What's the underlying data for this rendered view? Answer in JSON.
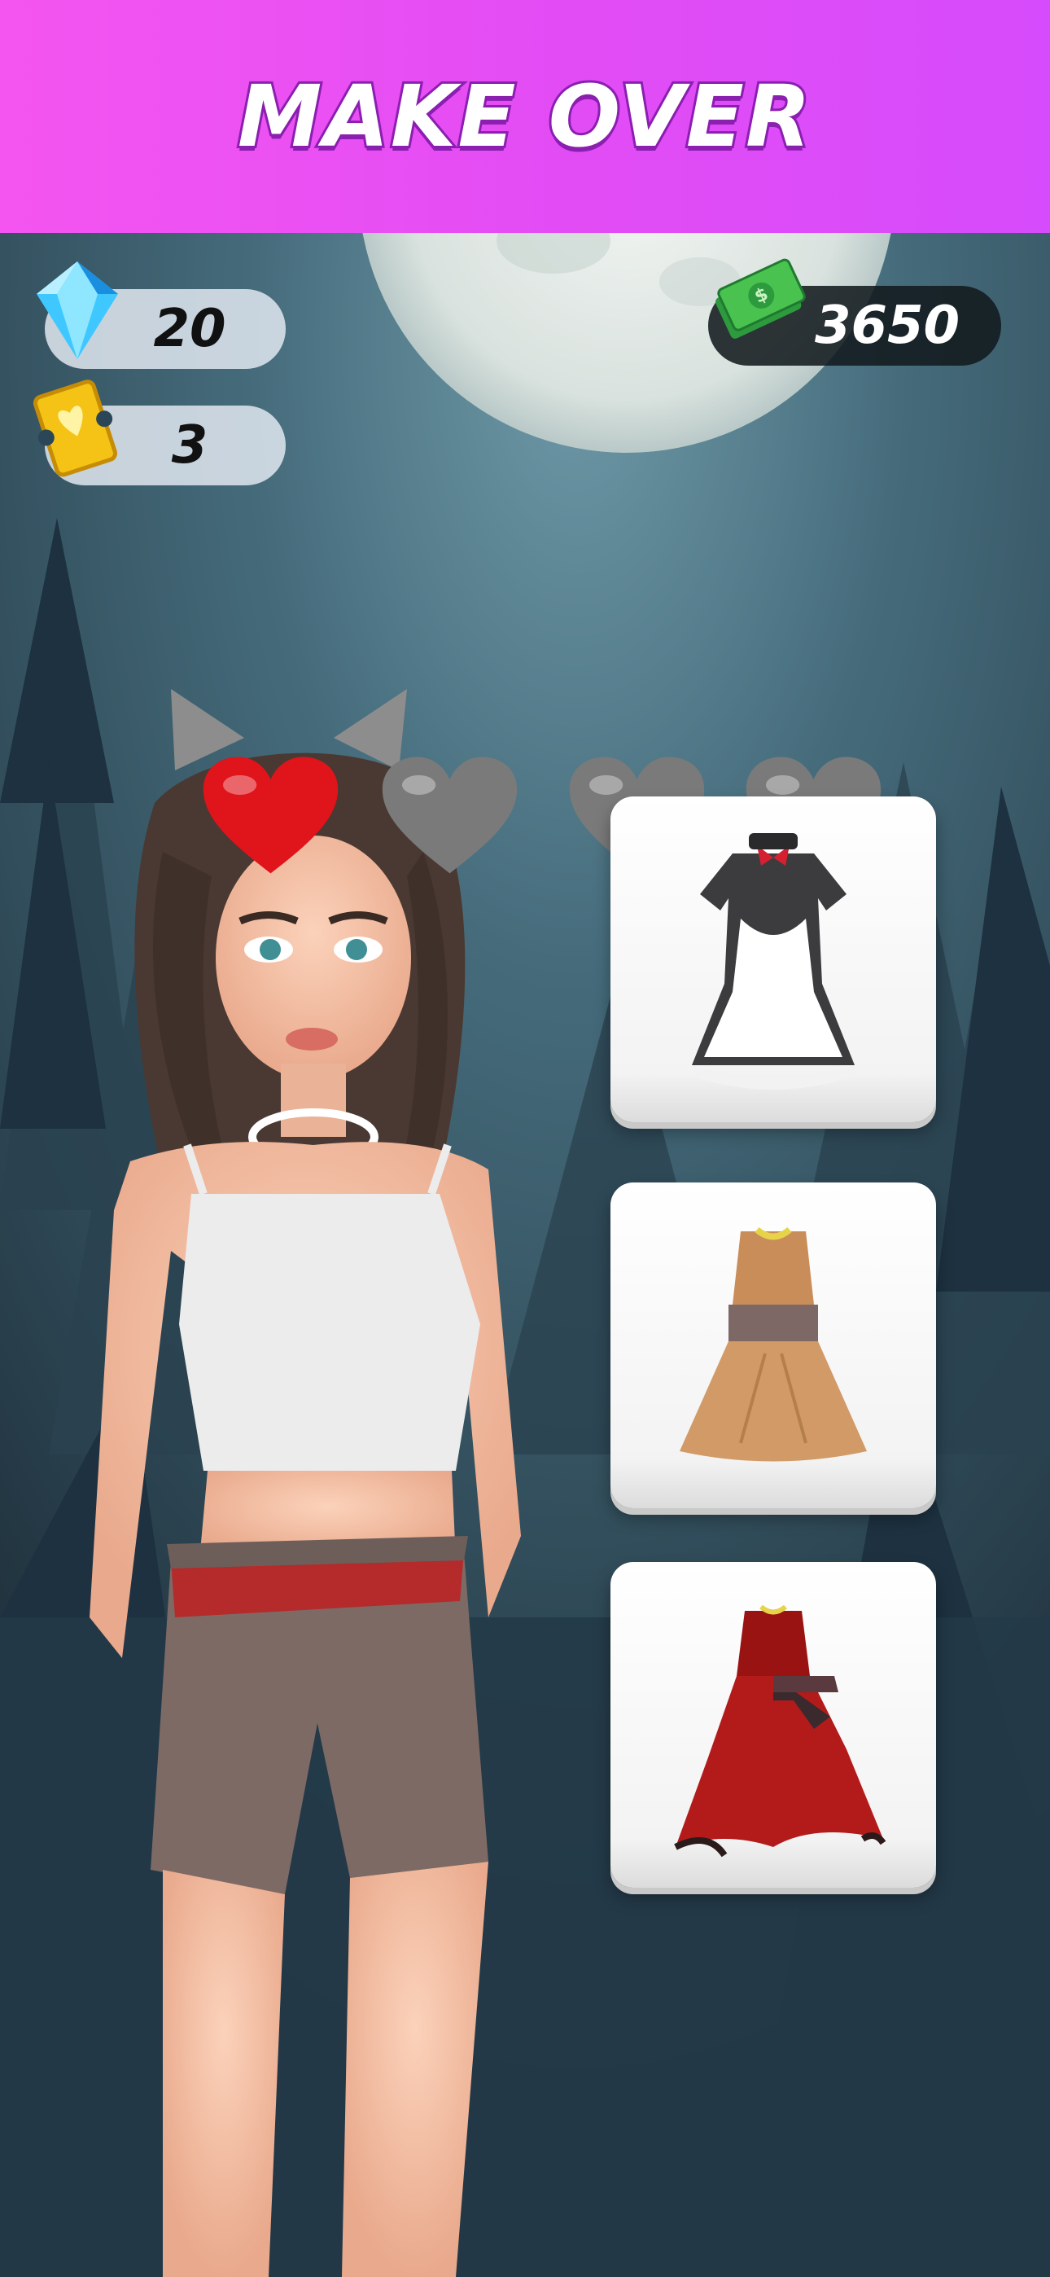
{
  "header": {
    "title": "MAKE OVER"
  },
  "currencies": {
    "gems": {
      "icon": "diamond-icon",
      "value": "20"
    },
    "tickets": {
      "icon": "ticket-icon",
      "value": "3"
    },
    "cash": {
      "icon": "cash-icon",
      "value": "3650"
    }
  },
  "progress": {
    "hearts_total": 4,
    "hearts_filled": 1,
    "filled_color": "#e0141b",
    "empty_color": "#7a7a7a"
  },
  "outfits": [
    {
      "name": "maid dress",
      "icon": "maid-dress-icon"
    },
    {
      "name": "tan dress",
      "icon": "tan-dress-icon"
    },
    {
      "name": "red gown",
      "icon": "red-gown-icon"
    }
  ],
  "colors": {
    "header_start": "#f455f0",
    "header_end": "#d64bfb",
    "sky": "#3f6474"
  }
}
